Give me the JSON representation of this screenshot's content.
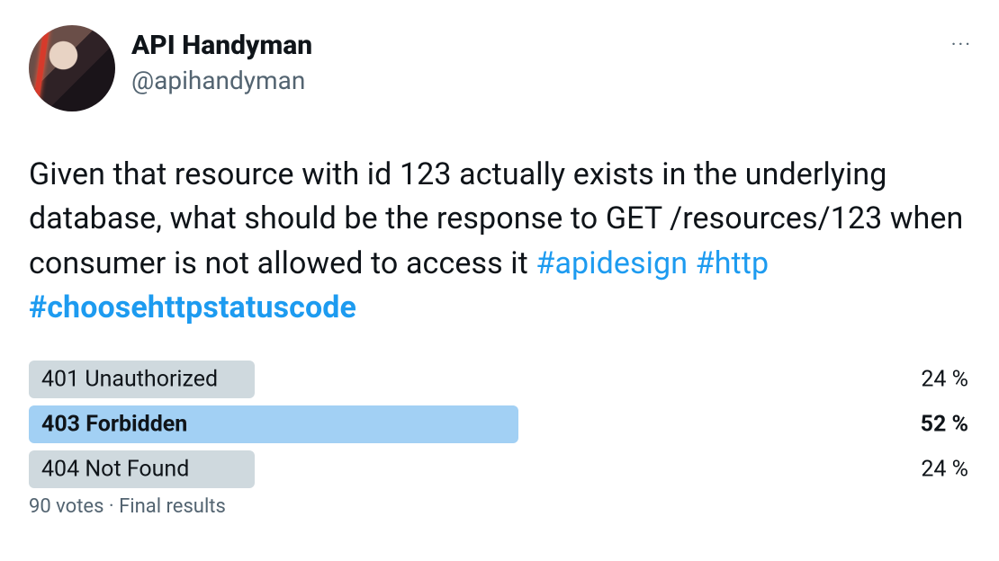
{
  "author": {
    "display_name": "API Handyman",
    "handle": "@apihandyman"
  },
  "tweet": {
    "text_plain": "Given that resource with id 123 actually exists in the underlying database, what should be the response to GET /resources/123 when consumer is not allowed to access it ",
    "hashtag1": "#apidesign",
    "hashtag2": "#http",
    "hashtag3": "#choosehttpstatuscode"
  },
  "chart_data": {
    "type": "bar",
    "title": "Twitter poll results",
    "categories": [
      "401 Unauthorized",
      "403 Forbidden",
      "404 Not Found"
    ],
    "values": [
      24,
      52,
      24
    ],
    "winner_index": 1,
    "xlabel": "",
    "ylabel": "percent",
    "ylim": [
      0,
      100
    ]
  },
  "poll": {
    "options": [
      {
        "label": "401 Unauthorized",
        "pct": "24 %",
        "width_pct": 24,
        "winner": false
      },
      {
        "label": "403 Forbidden",
        "pct": "52 %",
        "width_pct": 52,
        "winner": true
      },
      {
        "label": "404 Not Found",
        "pct": "24 %",
        "width_pct": 24,
        "winner": false
      }
    ],
    "footer": "90 votes · Final results"
  },
  "ui": {
    "more": "···"
  }
}
